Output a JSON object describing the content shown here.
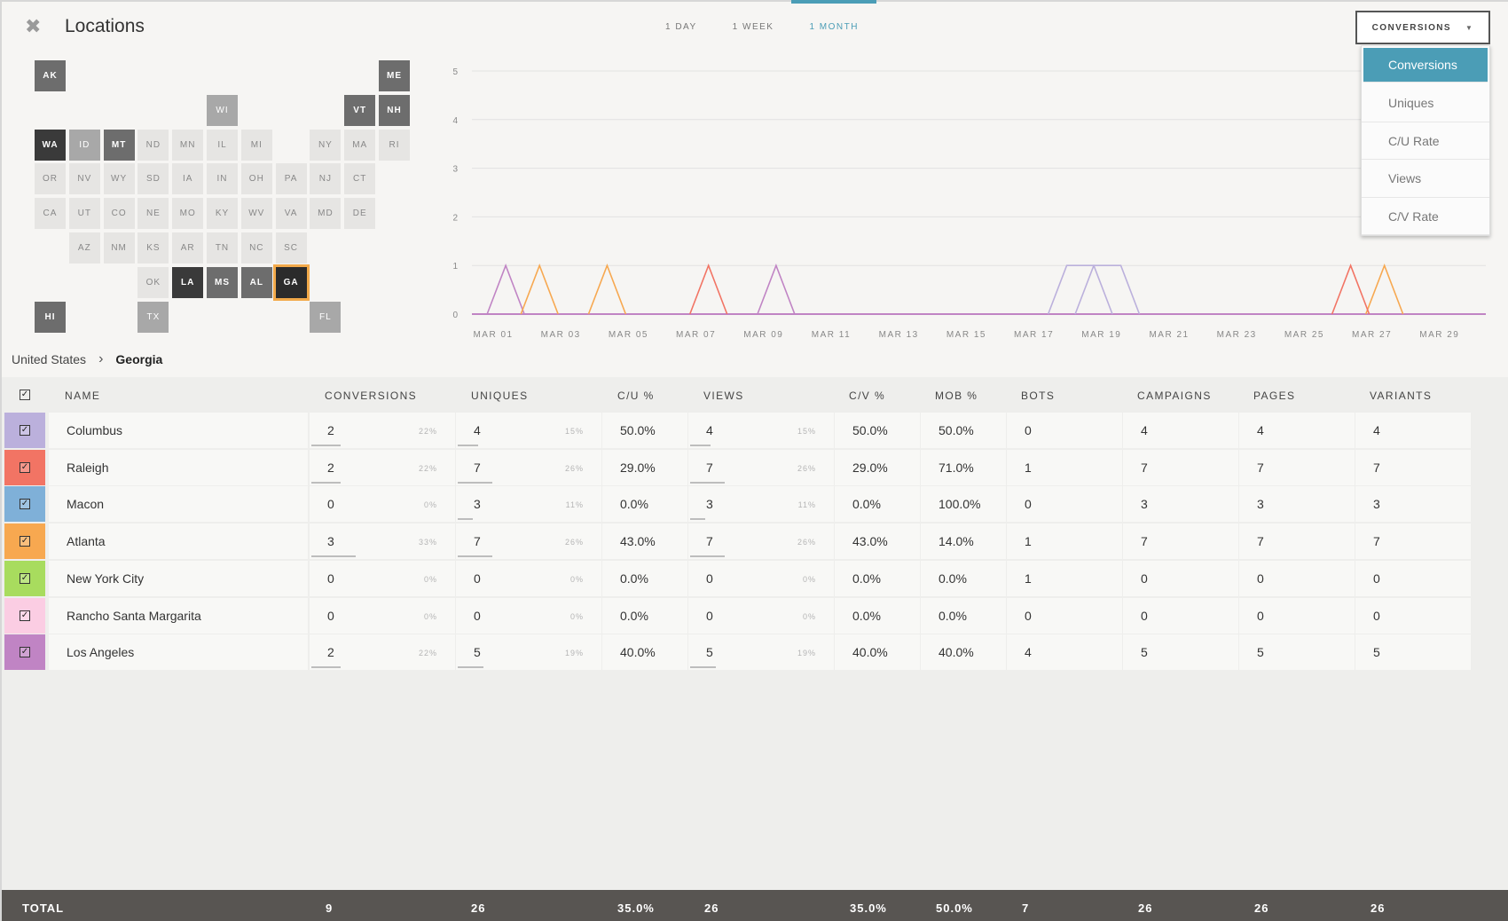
{
  "header": {
    "title": "Locations",
    "tabs": [
      {
        "label": "1 DAY",
        "active": false
      },
      {
        "label": "1 WEEK",
        "active": false
      },
      {
        "label": "1 MONTH",
        "active": true
      }
    ]
  },
  "dropdown": {
    "selected": "CONVERSIONS",
    "options": [
      "Conversions",
      "Uniques",
      "C/U Rate",
      "Views",
      "C/V Rate"
    ],
    "active_option": "Conversions"
  },
  "tile_map": {
    "states": [
      {
        "abbr": "AK",
        "shade": "dark"
      },
      {
        "abbr": "ME",
        "shade": "dark"
      },
      {
        "abbr": "WI",
        "shade": "mid"
      },
      {
        "abbr": "VT",
        "shade": "dark"
      },
      {
        "abbr": "NH",
        "shade": "dark"
      },
      {
        "abbr": "WA",
        "shade": "darker"
      },
      {
        "abbr": "ID",
        "shade": "mid"
      },
      {
        "abbr": "MT",
        "shade": "dark"
      },
      {
        "abbr": "ND",
        "shade": "light"
      },
      {
        "abbr": "MN",
        "shade": "light"
      },
      {
        "abbr": "IL",
        "shade": "light"
      },
      {
        "abbr": "MI",
        "shade": "light"
      },
      {
        "abbr": "NY",
        "shade": "light"
      },
      {
        "abbr": "MA",
        "shade": "light"
      },
      {
        "abbr": "RI",
        "shade": "light"
      },
      {
        "abbr": "OR",
        "shade": "light"
      },
      {
        "abbr": "NV",
        "shade": "light"
      },
      {
        "abbr": "WY",
        "shade": "light"
      },
      {
        "abbr": "SD",
        "shade": "light"
      },
      {
        "abbr": "IA",
        "shade": "light"
      },
      {
        "abbr": "IN",
        "shade": "light"
      },
      {
        "abbr": "OH",
        "shade": "light"
      },
      {
        "abbr": "PA",
        "shade": "light"
      },
      {
        "abbr": "NJ",
        "shade": "light"
      },
      {
        "abbr": "CT",
        "shade": "light"
      },
      {
        "abbr": "CA",
        "shade": "light"
      },
      {
        "abbr": "UT",
        "shade": "light"
      },
      {
        "abbr": "CO",
        "shade": "light"
      },
      {
        "abbr": "NE",
        "shade": "light"
      },
      {
        "abbr": "MO",
        "shade": "light"
      },
      {
        "abbr": "KY",
        "shade": "light"
      },
      {
        "abbr": "WV",
        "shade": "light"
      },
      {
        "abbr": "VA",
        "shade": "light"
      },
      {
        "abbr": "MD",
        "shade": "light"
      },
      {
        "abbr": "DE",
        "shade": "light"
      },
      {
        "abbr": "AZ",
        "shade": "light"
      },
      {
        "abbr": "NM",
        "shade": "light"
      },
      {
        "abbr": "KS",
        "shade": "light"
      },
      {
        "abbr": "AR",
        "shade": "light"
      },
      {
        "abbr": "TN",
        "shade": "light"
      },
      {
        "abbr": "NC",
        "shade": "light"
      },
      {
        "abbr": "SC",
        "shade": "light"
      },
      {
        "abbr": "OK",
        "shade": "light"
      },
      {
        "abbr": "LA",
        "shade": "darker"
      },
      {
        "abbr": "MS",
        "shade": "dark"
      },
      {
        "abbr": "AL",
        "shade": "dark"
      },
      {
        "abbr": "GA",
        "shade": "selected"
      },
      {
        "abbr": "HI",
        "shade": "dark"
      },
      {
        "abbr": "TX",
        "shade": "mid"
      },
      {
        "abbr": "FL",
        "shade": "mid"
      }
    ]
  },
  "chart_data": {
    "type": "line",
    "title": "",
    "xlabel": "",
    "ylabel": "",
    "x_tick_labels": [
      "MAR 01",
      "MAR 03",
      "MAR 05",
      "MAR 07",
      "MAR 09",
      "MAR 11",
      "MAR 13",
      "MAR 15",
      "MAR 17",
      "MAR 19",
      "MAR 21",
      "MAR 23",
      "MAR 25",
      "MAR 27",
      "MAR 29"
    ],
    "y_ticks": [
      0,
      1,
      2,
      3,
      4,
      5
    ],
    "ylim": [
      0,
      5
    ],
    "x_range": [
      "MAR 01",
      "MAR 31"
    ],
    "grid": true,
    "series": [
      {
        "color": "#c084c4",
        "points": [
          [
            2,
            1
          ],
          [
            10,
            1
          ],
          [
            30,
            0
          ]
        ]
      },
      {
        "color": "#f7a850",
        "points": [
          [
            3,
            1
          ],
          [
            5,
            1
          ],
          [
            28,
            1
          ]
        ]
      },
      {
        "color": "#f27464",
        "points": [
          [
            8,
            1
          ],
          [
            27,
            1
          ]
        ]
      },
      {
        "color": "#bbb0dc",
        "points": [
          [
            18.6,
            1
          ],
          [
            19.4,
            1
          ]
        ]
      }
    ]
  },
  "breadcrumb": {
    "root": "United States",
    "current": "Georgia"
  },
  "table": {
    "headers": [
      "NAME",
      "CONVERSIONS",
      "UNIQUES",
      "C/U %",
      "VIEWS",
      "C/V %",
      "MOB %",
      "BOTS",
      "CAMPAIGNS",
      "PAGES",
      "VARIANTS"
    ],
    "rows": [
      {
        "color": "#bbb0dc",
        "name": "Columbus",
        "conversions": "2",
        "conv_pct": "22%",
        "uniques": "4",
        "uniq_pct": "15%",
        "cu": "50.0%",
        "views": "4",
        "views_pct": "15%",
        "cv": "50.0%",
        "mob": "50.0%",
        "bots": "0",
        "campaigns": "4",
        "pages": "4",
        "variants": "4"
      },
      {
        "color": "#f27464",
        "name": "Raleigh",
        "conversions": "2",
        "conv_pct": "22%",
        "uniques": "7",
        "uniq_pct": "26%",
        "cu": "29.0%",
        "views": "7",
        "views_pct": "26%",
        "cv": "29.0%",
        "mob": "71.0%",
        "bots": "1",
        "campaigns": "7",
        "pages": "7",
        "variants": "7"
      },
      {
        "color": "#7fb0d8",
        "name": "Macon",
        "conversions": "0",
        "conv_pct": "0%",
        "uniques": "3",
        "uniq_pct": "11%",
        "cu": "0.0%",
        "views": "3",
        "views_pct": "11%",
        "cv": "0.0%",
        "mob": "100.0%",
        "bots": "0",
        "campaigns": "3",
        "pages": "3",
        "variants": "3"
      },
      {
        "color": "#f7a850",
        "name": "Atlanta",
        "conversions": "3",
        "conv_pct": "33%",
        "uniques": "7",
        "uniq_pct": "26%",
        "cu": "43.0%",
        "views": "7",
        "views_pct": "26%",
        "cv": "43.0%",
        "mob": "14.0%",
        "bots": "1",
        "campaigns": "7",
        "pages": "7",
        "variants": "7"
      },
      {
        "color": "#a8dc5e",
        "name": "New York City",
        "conversions": "0",
        "conv_pct": "0%",
        "uniques": "0",
        "uniq_pct": "0%",
        "cu": "0.0%",
        "views": "0",
        "views_pct": "0%",
        "cv": "0.0%",
        "mob": "0.0%",
        "bots": "1",
        "campaigns": "0",
        "pages": "0",
        "variants": "0"
      },
      {
        "color": "#fbcde3",
        "name": "Rancho Santa Margarita",
        "conversions": "0",
        "conv_pct": "0%",
        "uniques": "0",
        "uniq_pct": "0%",
        "cu": "0.0%",
        "views": "0",
        "views_pct": "0%",
        "cv": "0.0%",
        "mob": "0.0%",
        "bots": "0",
        "campaigns": "0",
        "pages": "0",
        "variants": "0"
      },
      {
        "color": "#c084c4",
        "name": "Los Angeles",
        "conversions": "2",
        "conv_pct": "22%",
        "uniques": "5",
        "uniq_pct": "19%",
        "cu": "40.0%",
        "views": "5",
        "views_pct": "19%",
        "cv": "40.0%",
        "mob": "40.0%",
        "bots": "4",
        "campaigns": "5",
        "pages": "5",
        "variants": "5"
      }
    ],
    "total": {
      "label": "TOTAL",
      "conversions": "9",
      "uniques": "26",
      "cu": "35.0%",
      "views": "26",
      "cv": "35.0%",
      "mob": "50.0%",
      "bots": "7",
      "campaigns": "26",
      "pages": "26",
      "variants": "26"
    }
  }
}
